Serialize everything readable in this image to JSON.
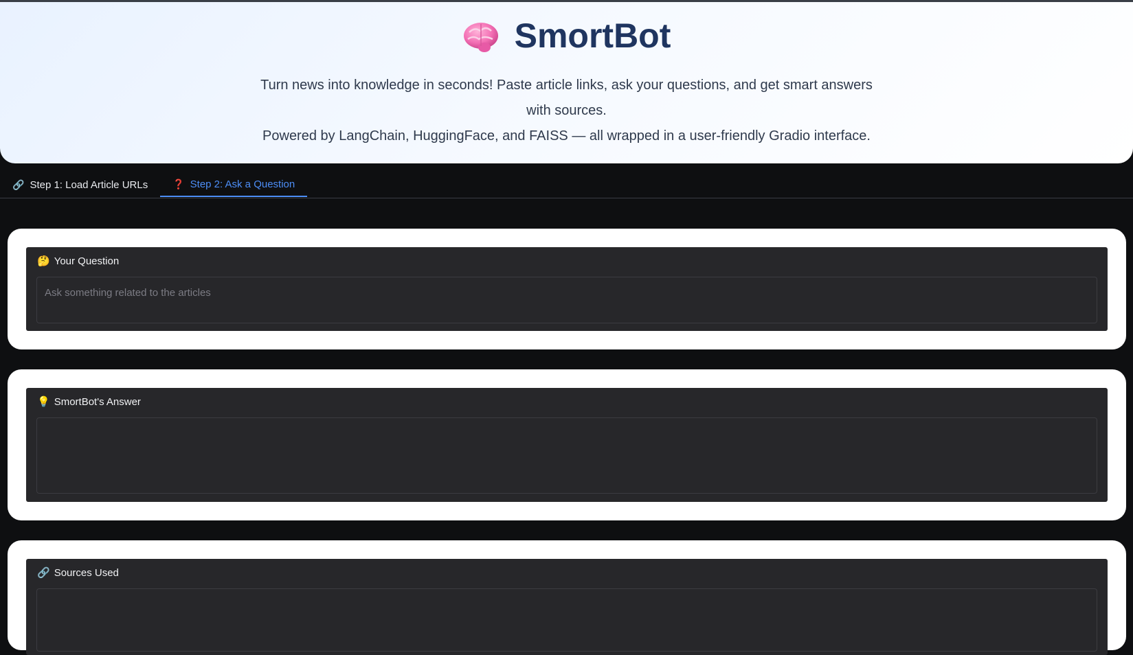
{
  "header": {
    "title": "SmortBot",
    "description_line1": "Turn news into knowledge in seconds! Paste article links, ask your questions, and get smart answers with sources.",
    "description_line2": "Powered by LangChain, HuggingFace, and FAISS — all wrapped in a user-friendly Gradio interface.",
    "icon": "brain-icon"
  },
  "tabs": [
    {
      "label": "Step 1: Load Article URLs",
      "icon": "link-icon",
      "glyph": "🔗",
      "active": false
    },
    {
      "label": "Step 2: Ask a Question",
      "icon": "question-icon",
      "glyph": "❓",
      "active": true
    }
  ],
  "question": {
    "label": "Your Question",
    "glyph": "🤔",
    "placeholder": "Ask something related to the articles",
    "value": ""
  },
  "answer": {
    "label": "SmortBot's Answer",
    "glyph": "💡",
    "value": ""
  },
  "sources": {
    "label": "Sources Used",
    "glyph": "🔗",
    "value": ""
  },
  "colors": {
    "accent": "#4d8ef7",
    "title": "#1f3560",
    "background": "#0e0f11",
    "panel": "#27272a"
  }
}
